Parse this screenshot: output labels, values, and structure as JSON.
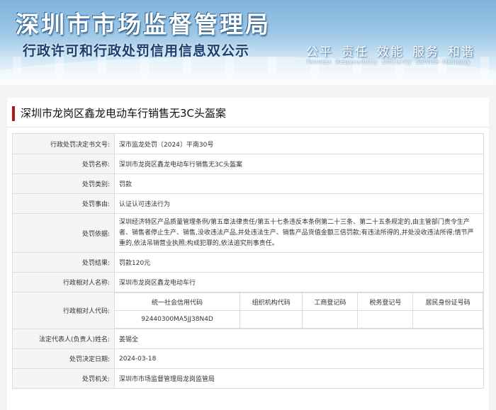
{
  "header": {
    "title": "深圳市市场监督管理局",
    "subtitle": "行政许可和行政处罚信用信息双公示",
    "slogan": [
      "公平",
      "责任",
      "效能",
      "服务",
      "和谐"
    ],
    "slogan_en": [
      "Fairness",
      "Responsibility",
      "Efficiency",
      "Service",
      "Harmony"
    ]
  },
  "case_title": "深圳市龙岗区鑫龙电动车行销售无3C头盔案",
  "fields": [
    {
      "label": "行政处罚决定书文号:",
      "value": "深市监龙处罚〔2024〕平南30号"
    },
    {
      "label": "处罚名称:",
      "value": "深圳市龙岗区鑫龙电动车行销售无3C头盔案"
    },
    {
      "label": "处罚类别:",
      "value": "罚款"
    },
    {
      "label": "处罚事由:",
      "value": "认证认可违法行为"
    },
    {
      "label": "处罚依据:",
      "value": "深圳经济特区产品质量管理条例/第五章法律责任/第五十七条违反本条例第二十三条、第二十五条规定的,由主管部门责令生产者、销售者停止生产、销售,没收违法产品,并处违法生产、销售产品货值金额三倍罚款;有违法所得的,并处没收违法所得;情节严重的,依法吊销营业执照;构成犯罪的,依法追究刑事责任。"
    },
    {
      "label": "处罚结果:",
      "value": "罚款120元"
    },
    {
      "label": "行政相对人名称:",
      "value": "深圳市龙岗区鑫龙电动车行"
    }
  ],
  "code_field": {
    "label": "行政相对人代码:",
    "headers": [
      "统一社会信用代码",
      "组织机构代码",
      "工商登记码",
      "税务登记号",
      "居民身份证号码"
    ],
    "values": [
      "92440300MA5JJ38N4D",
      "",
      "",
      "",
      ""
    ]
  },
  "fields_after": [
    {
      "label": "法定代表人(负责人)姓名:",
      "value": "姜锡全"
    },
    {
      "label": "处罚决定日期:",
      "value": "2024-03-18"
    },
    {
      "label": "处罚机关:",
      "value": "深圳市市场监督管理局龙岗监管局"
    }
  ]
}
